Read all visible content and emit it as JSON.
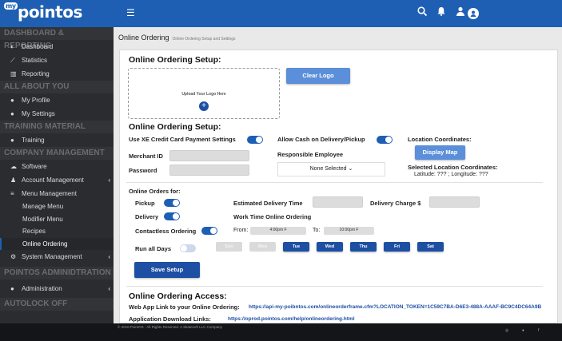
{
  "header": {
    "logo_text": "pointos",
    "logo_badge": "my",
    "menu_icon": "☰",
    "icons": [
      "search-icon",
      "bell-icon",
      "user-icon",
      "account-icon"
    ]
  },
  "sidebar": {
    "sec1": "DASHBOARD & REPORTING",
    "dashboard": "Dashboard",
    "statistics": "Statistics",
    "reporting": "Reporting",
    "sec2": "ALL ABOUT YOU",
    "profile": "My Profile",
    "settings": "My Settings",
    "sec3": "TRAINING MATERIAL",
    "training": "Training",
    "sec4": "COMPANY MANAGEMENT",
    "software": "Software",
    "account": "Account Management",
    "menu": "Menu Management",
    "manage": "Manage Menu",
    "modifier": "Modifier Menu",
    "recipes": "Recipes",
    "online": "Online Ordering",
    "system": "System Management",
    "sec5": "POINTOS ADMINIDTRATION",
    "admin": "Administration",
    "sec6": "AUTOLOCK OFF"
  },
  "crumb": {
    "title": "Online Ordering",
    "subtitle": "Online Ordering Setup and Settings"
  },
  "setup": {
    "h1": "Online Ordering Setup:",
    "upload": "Upload Your Logo Here",
    "clear": "Clear Logo",
    "h2": "Online Ordering Setup:",
    "xe": "Use XE Credit Card Payment Settings",
    "merchant": "Merchant ID",
    "password": "Password",
    "cash": "Allow Cash on Delivery/Pickup",
    "employee": "Responsible Employee",
    "none": "None Selected",
    "loc": "Location Coordinates:",
    "display": "Display Map",
    "selloc": "Selected Location Coordinates:",
    "latlon": "Latitude: ??? ; Longitude: ???"
  },
  "orders": {
    "for": "Online Orders for:",
    "pickup": "Pickup",
    "delivery": "Delivery",
    "contactless": "Contactless Ordering",
    "eta": "Estimated Delivery Time",
    "charge": "Delivery Charge $",
    "work": "Work Time Online Ordering",
    "from": "From:",
    "to": "To:",
    "from_val": "4:00pm F",
    "to_val": "10:00pm F",
    "runall": "Run all Days",
    "days": [
      "Sun",
      "Mon",
      "Tue",
      "Wed",
      "Thu",
      "Fri",
      "Sat"
    ],
    "days_on": [
      false,
      false,
      true,
      true,
      true,
      true,
      true
    ],
    "save": "Save Setup"
  },
  "access": {
    "h": "Online Ordering Access:",
    "web_lbl": "Web App Link to your Online Ordering:",
    "web_url": "https://api-my-poibntos.com/onlineorderframe.cfm?LOCATION_TOKEN=1C59C7BA-D6E3-488A-AAAF-BC9C4DC64A9B",
    "dl_lbl": "Application Download Links:",
    "dl_url": "https://oprod.pointos.com/help/onlineordering.html"
  },
  "footer": {
    "copy": "©  2018 PointOS - All Rights Reserved. A Skatesoft LLC Company"
  }
}
